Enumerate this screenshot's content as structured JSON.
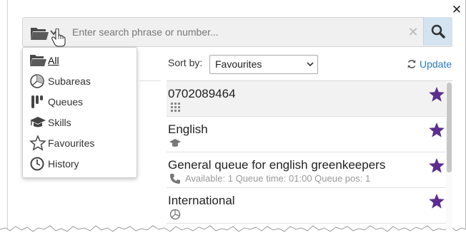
{
  "search": {
    "placeholder": "Enter search phrase or number...",
    "value": ""
  },
  "scope_menu": {
    "items": [
      {
        "label": "All",
        "icon": "folder-icon",
        "active": true
      },
      {
        "label": "Subareas",
        "icon": "subareas-pie-icon",
        "active": false
      },
      {
        "label": "Queues",
        "icon": "queues-icon",
        "active": false
      },
      {
        "label": "Skills",
        "icon": "graduation-cap-icon",
        "active": false
      },
      {
        "label": "Favourites",
        "icon": "star-outline-icon",
        "active": false
      },
      {
        "label": "History",
        "icon": "clock-icon",
        "active": false
      }
    ]
  },
  "toolbar": {
    "sort_label": "Sort by:",
    "sort_value": "Favourites",
    "update_label": "Update"
  },
  "results": [
    {
      "title": "0702089464",
      "icon": "dialpad-icon",
      "detail": "",
      "favourite": true
    },
    {
      "title": "English",
      "icon": "graduation-cap-icon",
      "detail": "",
      "favourite": true
    },
    {
      "title": "General queue for english greenkeepers",
      "icon": "phone-icon",
      "detail": "Available: 1 Queue time: 01:00 Queue pos: 1",
      "favourite": true
    },
    {
      "title": "International",
      "icon": "subareas-pie-icon",
      "detail": "",
      "favourite": true
    }
  ],
  "colors": {
    "star": "#5b2d8e",
    "link": "#2a78c2",
    "search_button": "#d3e3ef"
  }
}
